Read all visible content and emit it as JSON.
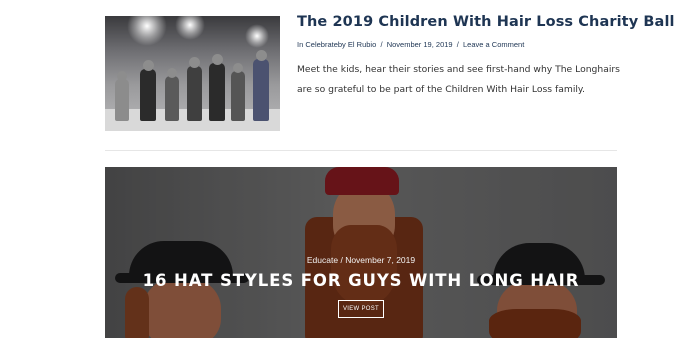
{
  "post": {
    "title": "The 2019 Children With Hair Loss Charity Ball",
    "meta_prefix": "In",
    "category": "Celebrate",
    "by_label": "by",
    "author": "El Rubio",
    "separator": "/",
    "date": "November 19, 2019",
    "comment_link": "Leave a Comment",
    "excerpt": "Meet the kids, hear their stories and see first-hand why The Longhairs are so grateful to be part of the Children With Hair Loss family."
  },
  "feature": {
    "category": "Educate",
    "separator": "/",
    "date": "November 7, 2019",
    "title": "16 HAT STYLES FOR GUYS WITH LONG HAIR",
    "button_label": "VIEW POST"
  }
}
